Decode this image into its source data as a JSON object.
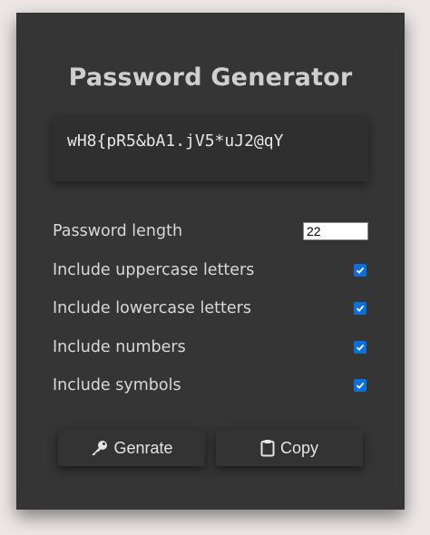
{
  "app": {
    "title": "Password Generator"
  },
  "result": {
    "password": "wH8{pR5&bA1.jV5*uJ2@qY"
  },
  "settings": {
    "length": {
      "label": "Password length",
      "value": "22"
    },
    "options": [
      {
        "label": "Include uppercase letters",
        "checked": true
      },
      {
        "label": "Include lowercase letters",
        "checked": true
      },
      {
        "label": "Include numbers",
        "checked": true
      },
      {
        "label": "Include symbols",
        "checked": true
      }
    ]
  },
  "buttons": {
    "generate": {
      "label": "Genrate",
      "icon": "key-icon"
    },
    "copy": {
      "label": "Copy",
      "icon": "clipboard-icon"
    }
  },
  "colors": {
    "page_bg": "#ece6e6",
    "card_bg": "#353535",
    "checkbox_accent": "#0b6fdc"
  }
}
